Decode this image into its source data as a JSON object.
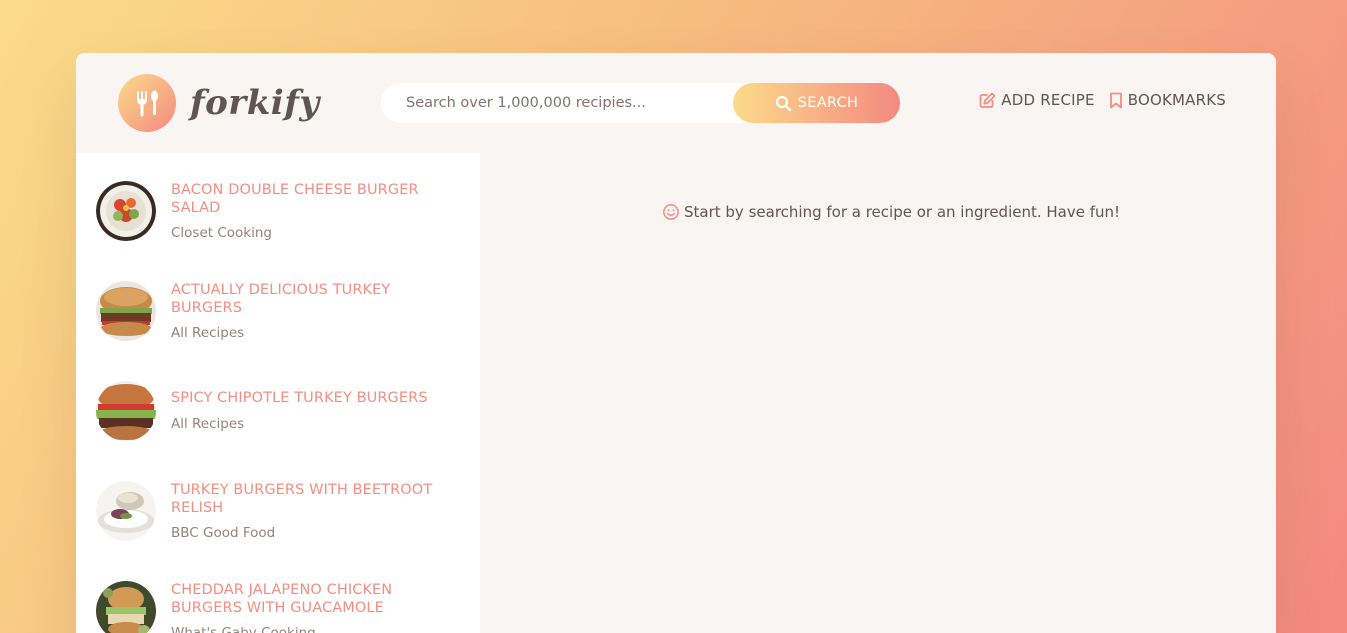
{
  "app": {
    "logo_text": "forkify"
  },
  "search": {
    "placeholder": "Search over 1,000,000 recipies...",
    "button_label": "SEARCH"
  },
  "nav": {
    "add_recipe": "ADD RECIPE",
    "bookmarks": "BOOKMARKS"
  },
  "results": [
    {
      "title": "BACON DOUBLE CHEESE BURGER SALAD",
      "publisher": "Closet Cooking",
      "image": "salad"
    },
    {
      "title": "ACTUALLY DELICIOUS TURKEY BURGERS",
      "publisher": "All Recipes",
      "image": "burger"
    },
    {
      "title": "SPICY CHIPOTLE TURKEY BURGERS",
      "publisher": "All Recipes",
      "image": "burger-lettuce"
    },
    {
      "title": "TURKEY BURGERS WITH BEETROOT RELISH",
      "publisher": "BBC Good Food",
      "image": "plate"
    },
    {
      "title": "CHEDDAR JALAPENO CHICKEN BURGERS WITH GUACAMOLE",
      "publisher": "What's Gaby Cooking",
      "image": "burger-guac"
    }
  ],
  "recipe": {
    "message": "Start by searching for a recipe or an ingredient. Have fun!"
  },
  "colors": {
    "accent": "#f38e82",
    "gradient_start": "#fbdb89",
    "gradient_end": "#f48982",
    "text": "#615551",
    "panel": "#f9f5f3"
  }
}
